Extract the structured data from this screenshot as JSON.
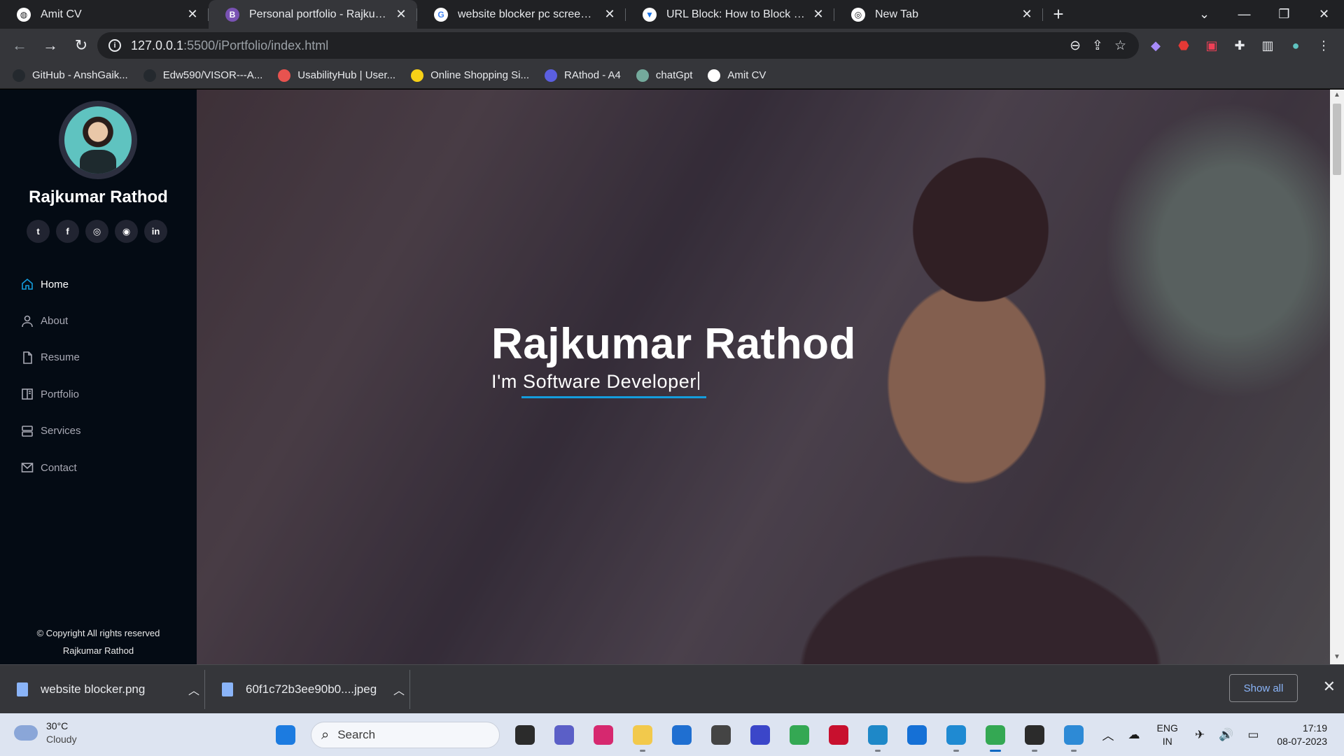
{
  "browser": {
    "tabs": [
      {
        "title": "Amit CV",
        "icon": "globe-icon",
        "active": false,
        "fav_bg": "#ffffff",
        "fav_fg": "#202124",
        "fav_glyph": "◍"
      },
      {
        "title": "Personal portfolio - Rajkumar",
        "icon": "bootstrap-icon",
        "active": true,
        "fav_bg": "#7952b3",
        "fav_fg": "#ffffff",
        "fav_glyph": "B"
      },
      {
        "title": "website blocker pc screen image",
        "icon": "google-icon",
        "active": false,
        "fav_bg": "#ffffff",
        "fav_fg": "#4285f4",
        "fav_glyph": "G"
      },
      {
        "title": "URL Block: How to Block Website",
        "icon": "shield-icon",
        "active": false,
        "fav_bg": "#ffffff",
        "fav_fg": "#1a73e8",
        "fav_glyph": "▼"
      },
      {
        "title": "New Tab",
        "icon": "chrome-icon",
        "active": false,
        "fav_bg": "#ffffff",
        "fav_fg": "#202124",
        "fav_glyph": "◎"
      }
    ],
    "url_host": "127.0.0.1",
    "url_path": ":5500/iPortfolio/index.html",
    "bookmarks": [
      {
        "label": "GitHub - AnshGaik...",
        "icon": "github-icon",
        "color": "#24292e"
      },
      {
        "label": "Edw590/VISOR---A...",
        "icon": "github-icon",
        "color": "#24292e"
      },
      {
        "label": "UsabilityHub | User...",
        "icon": "usabilityhub-icon",
        "color": "#e8534f"
      },
      {
        "label": "Online Shopping Si...",
        "icon": "flipkart-icon",
        "color": "#f7d117"
      },
      {
        "label": "RAthod - A4",
        "icon": "document-icon",
        "color": "#5b5fe0"
      },
      {
        "label": "chatGpt",
        "icon": "chatgpt-icon",
        "color": "#74aa9c"
      },
      {
        "label": "Amit CV",
        "icon": "globe-icon",
        "color": "#ffffff"
      }
    ]
  },
  "sidebar": {
    "name": "Rajkumar Rathod",
    "socials": [
      {
        "icon": "twitter-icon",
        "glyph": "t"
      },
      {
        "icon": "facebook-icon",
        "glyph": "f"
      },
      {
        "icon": "instagram-icon",
        "glyph": "◎"
      },
      {
        "icon": "github-icon",
        "glyph": "◉"
      },
      {
        "icon": "linkedin-icon",
        "glyph": "in"
      }
    ],
    "menu": [
      {
        "label": "Home",
        "icon": "home-icon",
        "active": true
      },
      {
        "label": "About",
        "icon": "person-icon",
        "active": false
      },
      {
        "label": "Resume",
        "icon": "file-icon",
        "active": false
      },
      {
        "label": "Portfolio",
        "icon": "book-icon",
        "active": false
      },
      {
        "label": "Services",
        "icon": "server-icon",
        "active": false
      },
      {
        "label": "Contact",
        "icon": "envelope-icon",
        "active": false
      }
    ],
    "copyright_line1": "© Copyright All rights reserved",
    "copyright_line2": "Rajkumar Rathod",
    "accent": "#149ddd"
  },
  "hero": {
    "title": "Rajkumar Rathod",
    "subtitle": "I'm Software Developer"
  },
  "downloads": {
    "items": [
      {
        "name": "website blocker.png"
      },
      {
        "name": "60f1c72b3ee90b0....jpeg"
      }
    ],
    "show_all_label": "Show all"
  },
  "taskbar": {
    "temperature": "30°C",
    "condition": "Cloudy",
    "search_placeholder": "Search",
    "apps": [
      {
        "icon": "windows-start-icon",
        "color": "#1c7be0",
        "open": false
      },
      {
        "icon": "task-view-icon",
        "color": "#2b2b2b",
        "open": false
      },
      {
        "icon": "teams-meet-icon",
        "color": "#5b5fc7",
        "open": false
      },
      {
        "icon": "instagram-icon",
        "color": "#d6286f",
        "open": false
      },
      {
        "icon": "file-explorer-icon",
        "color": "#f2c94c",
        "open": true
      },
      {
        "icon": "microsoft-store-icon",
        "color": "#1f6fd1",
        "open": false
      },
      {
        "icon": "unity-icon",
        "color": "#444444",
        "open": false
      },
      {
        "icon": "vector-app-icon",
        "color": "#3b46c9",
        "open": false
      },
      {
        "icon": "chrome-icon",
        "color": "#34a853",
        "open": false
      },
      {
        "icon": "media-app-icon",
        "color": "#c8102e",
        "open": false
      },
      {
        "icon": "edge-icon",
        "color": "#1e88c8",
        "open": true
      },
      {
        "icon": "mail-icon",
        "color": "#1570d6",
        "open": false
      },
      {
        "icon": "vscode-icon",
        "color": "#1f8ad2",
        "open": true
      },
      {
        "icon": "chrome-active-icon",
        "color": "#34a853",
        "open": true,
        "focused": true
      },
      {
        "icon": "media-player-icon",
        "color": "#2b2b2b",
        "open": true
      },
      {
        "icon": "photos-icon",
        "color": "#2d8ad6",
        "open": true
      }
    ],
    "lang_line1": "ENG",
    "lang_line2": "IN",
    "time": "17:19",
    "date": "08-07-2023"
  }
}
